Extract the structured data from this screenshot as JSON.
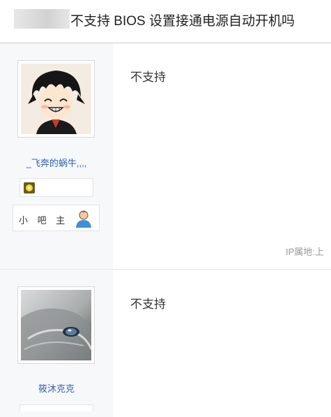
{
  "header": {
    "title": "不支持 BIOS 设置接通电源自动开机吗"
  },
  "posts": [
    {
      "username": "_飞奔的蜗牛,,,,",
      "role": "小 吧 主",
      "content": "不支持",
      "ip": "IP属地:上"
    },
    {
      "username": "筱沐克克",
      "content": "不支持"
    }
  ],
  "icons": {
    "badge": "level-badge-icon",
    "role": "user-icon"
  },
  "colors": {
    "link": "#3163b2",
    "sidebar_bg": "#f7f8fa"
  }
}
